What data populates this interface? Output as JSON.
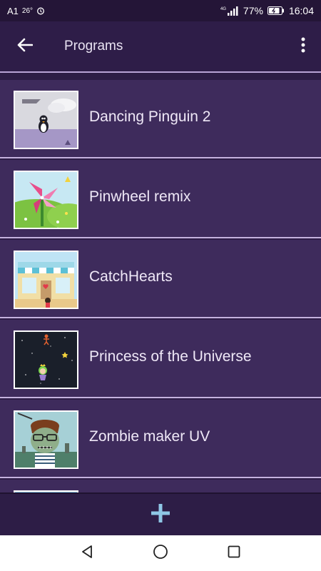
{
  "status": {
    "carrier": "A1",
    "temperature": "26°",
    "network": "4G",
    "battery": "77%",
    "time": "16:04"
  },
  "appbar": {
    "title": "Programs",
    "back_icon": "arrow-left-icon",
    "menu_icon": "more-vertical-icon"
  },
  "programs": [
    {
      "name": "Dancing Pinguin 2",
      "thumb": "penguin-snow-thumbnail"
    },
    {
      "name": "Pinwheel remix",
      "thumb": "pinwheel-meadow-thumbnail"
    },
    {
      "name": "CatchHearts",
      "thumb": "shop-street-thumbnail"
    },
    {
      "name": "Princess of the Universe",
      "thumb": "space-princess-thumbnail"
    },
    {
      "name": "Zombie maker UV",
      "thumb": "zombie-face-thumbnail"
    }
  ],
  "fab": {
    "icon": "plus-icon",
    "color": "#8fc7e6"
  },
  "navbar": {
    "back": "triangle-back-icon",
    "home": "circle-home-icon",
    "recents": "square-recents-icon"
  },
  "colors": {
    "accent": "#b9a4d6",
    "item_bg": "#3e2b5c",
    "page_bg": "#2d1d46"
  }
}
